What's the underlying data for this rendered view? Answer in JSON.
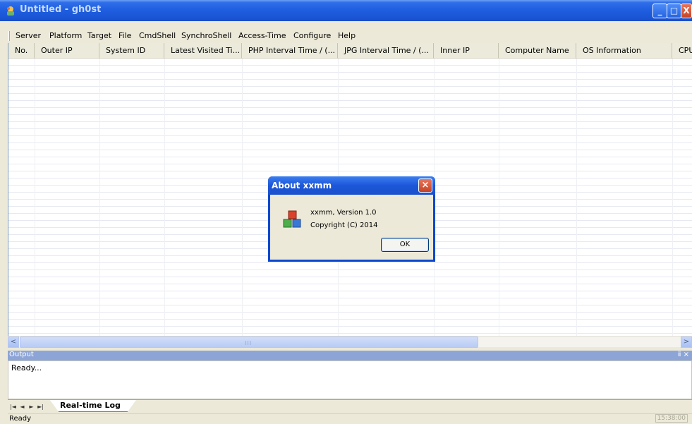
{
  "window": {
    "title": "Untitled - gh0st",
    "buttons": {
      "minimize": "_",
      "maximize": "□",
      "close": "X"
    }
  },
  "menu": [
    "Server",
    "Platform",
    "Target",
    "File",
    "CmdShell",
    "SynchroShell",
    "Access-Time",
    "Configure",
    "Help"
  ],
  "list": {
    "columns": [
      "No.",
      "Outer IP",
      "System ID",
      "Latest Visited Ti...",
      "PHP Interval Time / (...",
      "JPG Interval Time / (...",
      "Inner IP",
      "Computer Name",
      "OS Information",
      "CPU"
    ],
    "rows": []
  },
  "scrollbar": {
    "left": "<",
    "right": ">",
    "grip": "III"
  },
  "output": {
    "title": "Output",
    "controls": "ⅱ ×",
    "text": "Ready..."
  },
  "tabs": {
    "nav": [
      "|◄",
      "◄",
      "►",
      "►|"
    ],
    "active": "Real-time Log"
  },
  "status": {
    "text": "Ready",
    "clock": "15:38:00"
  },
  "dialog": {
    "title": "About xxmm",
    "close": "×",
    "line1": "xxmm, Version 1.0",
    "line2": "Copyright (C) 2014",
    "ok": "OK"
  },
  "colors": {
    "titlebar": "#1f5fe0",
    "dialog_border": "#0a47d1",
    "output_header": "#8da5d6"
  }
}
